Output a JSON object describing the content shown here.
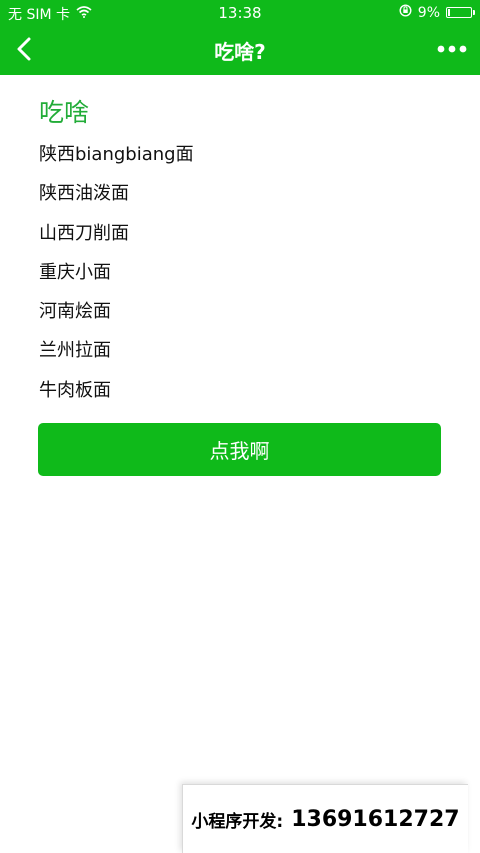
{
  "status_bar": {
    "carrier": "无 SIM 卡",
    "time": "13:38",
    "battery_percent": "9%",
    "battery_level": 0.09
  },
  "navbar": {
    "title": "吃啥?",
    "back_icon": "chevron-left-icon",
    "more_icon": "more-dots-icon"
  },
  "main": {
    "heading": "吃啥",
    "items": [
      "陕西biangbiang面",
      "陕西油泼面",
      "山西刀削面",
      "重庆小面",
      "河南烩面",
      "兰州拉面",
      "牛肉板面"
    ],
    "button_label": "点我啊"
  },
  "promo": {
    "label": "小程序开发:",
    "phone": "13691612727"
  },
  "colors": {
    "brand_green": "#0fba1a",
    "heading_green": "#22ac38"
  }
}
